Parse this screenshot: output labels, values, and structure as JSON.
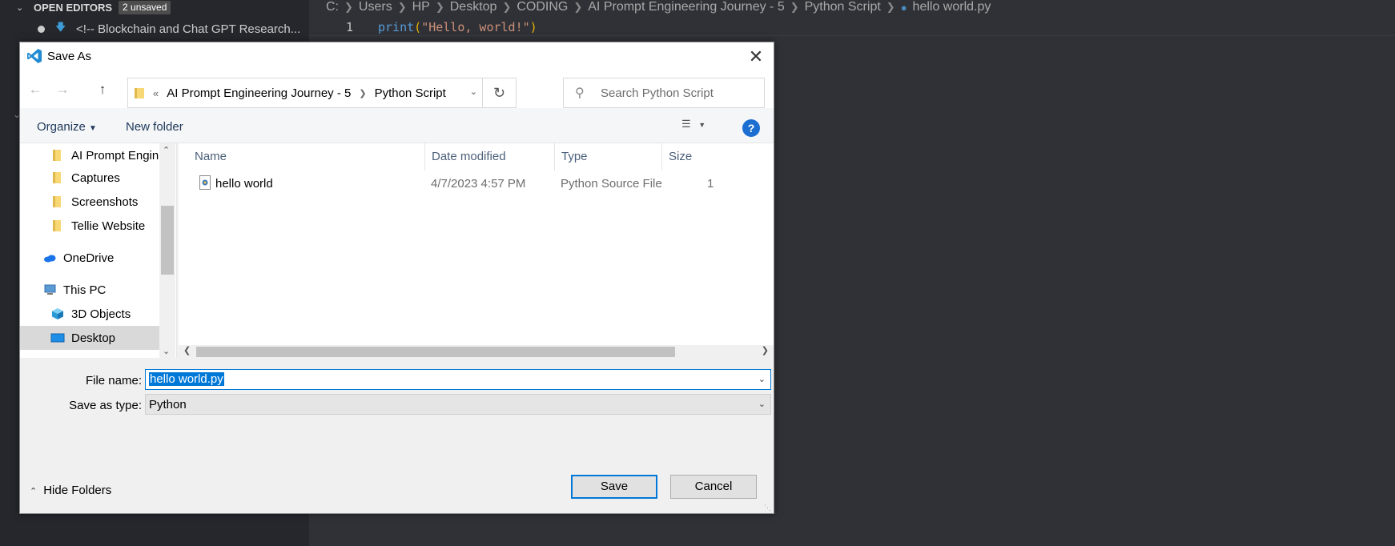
{
  "vscode": {
    "open_editors_label": "OPEN EDITORS",
    "unsaved_badge": "2 unsaved",
    "open_editor_item": "<!-- Blockchain and Chat GPT Research...",
    "breadcrumbs": [
      "C:",
      "Users",
      "HP",
      "Desktop",
      "CODING",
      "AI Prompt Engineering Journey - 5",
      "Python Script",
      "hello world.py"
    ],
    "line_number": "1",
    "code": {
      "fn": "print",
      "open": "(",
      "str": "\"Hello, world!\"",
      "close": ")"
    }
  },
  "dialog": {
    "title": "Save As",
    "address": {
      "overflow": "«",
      "segments": [
        "AI Prompt Engineering Journey - 5",
        "Python Script"
      ]
    },
    "search_placeholder": "Search Python Script",
    "toolbar": {
      "organize": "Organize",
      "new_folder": "New folder",
      "help": "?"
    },
    "nav_tree": [
      {
        "label": "AI Prompt Engin",
        "icon": "folder-icon"
      },
      {
        "label": "Captures",
        "icon": "folder-icon"
      },
      {
        "label": "Screenshots",
        "icon": "folder-icon"
      },
      {
        "label": "Tellie Website",
        "icon": "folder-icon"
      },
      {
        "label": "OneDrive",
        "icon": "onedrive-icon"
      },
      {
        "label": "This PC",
        "icon": "computer-icon"
      },
      {
        "label": "3D Objects",
        "icon": "3d-objects-icon"
      },
      {
        "label": "Desktop",
        "icon": "desktop-icon",
        "selected": true
      }
    ],
    "columns": [
      "Name",
      "Date modified",
      "Type",
      "Size"
    ],
    "files": [
      {
        "name": "hello world",
        "date": "4/7/2023 4:57 PM",
        "type": "Python Source File",
        "size": "1"
      }
    ],
    "file_name_label": "File name:",
    "file_name_value": "hello world.py",
    "save_type_label": "Save as type:",
    "save_type_value": "Python",
    "hide_folders": "Hide Folders",
    "save_button": "Save",
    "cancel_button": "Cancel"
  },
  "colors": {
    "accent": "#0078d7",
    "help": "#1c6fd1",
    "folder": "#f8d775"
  }
}
